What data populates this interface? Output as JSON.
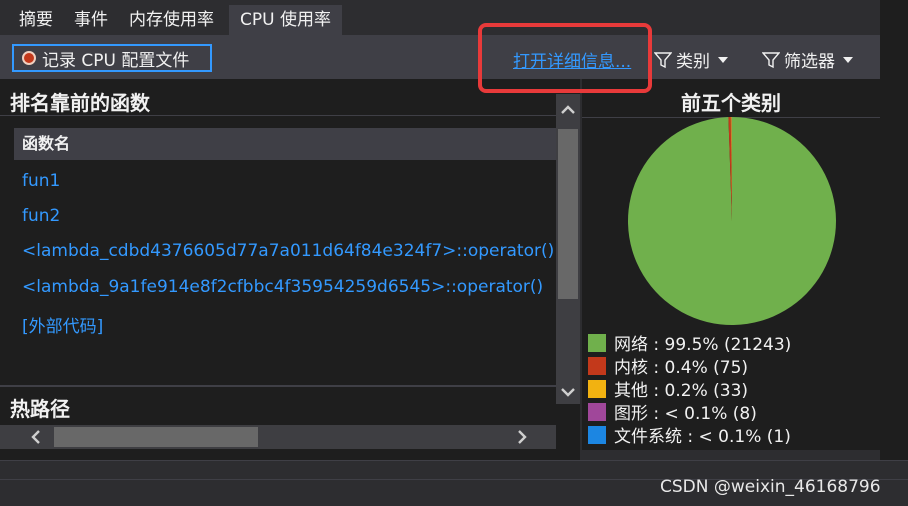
{
  "tabs": [
    {
      "label": "摘要"
    },
    {
      "label": "事件"
    },
    {
      "label": "内存使用率"
    },
    {
      "label": "CPU 使用率",
      "active": true
    }
  ],
  "toolbar": {
    "record_label": "记录 CPU 配置文件",
    "detail_link": "打开详细信息...",
    "category_label": "类别",
    "filter_label": "筛选器"
  },
  "top_functions": {
    "title": "排名靠前的函数",
    "column_header": "函数名",
    "rows": [
      {
        "name": "fun1"
      },
      {
        "name": "fun2"
      },
      {
        "name": "<lambda_cdbd4376605d77a7a011d64f84e324f7>::operator()"
      },
      {
        "name": "<lambda_9a1fe914e8f2cfbbc4f35954259d6545>::operator()"
      },
      {
        "name": "[外部代码]"
      }
    ]
  },
  "hot_path": {
    "title": "热路径"
  },
  "pie": {
    "title": "前五个类别",
    "legend": [
      {
        "label": "网络 : 99.5% (21243)",
        "color": "#70b04c"
      },
      {
        "label": "内核 : 0.4% (75)",
        "color": "#c3391b"
      },
      {
        "label": "其他 : 0.2% (33)",
        "color": "#f2b211"
      },
      {
        "label": "图形 : < 0.1% (8)",
        "color": "#a0479a"
      },
      {
        "label": "文件系统 : < 0.1% (1)",
        "color": "#1c86e2"
      }
    ]
  },
  "chart_data": {
    "type": "pie",
    "title": "前五个类别",
    "categories": [
      "网络",
      "内核",
      "其他",
      "图形",
      "文件系统"
    ],
    "values": [
      21243,
      75,
      33,
      8,
      1
    ],
    "colors": [
      "#70b04c",
      "#c3391b",
      "#f2b211",
      "#a0479a",
      "#1c86e2"
    ]
  },
  "watermark": "CSDN @weixin_46168796",
  "colors": {
    "accent": "#3399ff",
    "highlight": "#e83a3a",
    "panel": "#1e1e1e",
    "chrome": "#2d2d30"
  }
}
